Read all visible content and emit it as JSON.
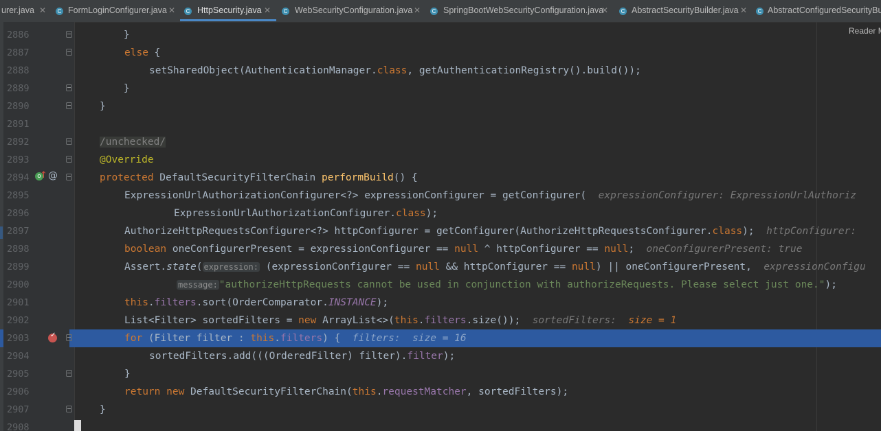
{
  "tabs": [
    {
      "label": "urer.java"
    },
    {
      "label": "FormLoginConfigurer.java"
    },
    {
      "label": "HttpSecurity.java"
    },
    {
      "label": "WebSecurityConfiguration.java"
    },
    {
      "label": "SpringBootWebSecurityConfiguration.java"
    },
    {
      "label": "AbstractSecurityBuilder.java"
    },
    {
      "label": "AbstractConfiguredSecurityBui"
    }
  ],
  "reader_mode_label": "Reader M",
  "lines": [
    {
      "n": "2886"
    },
    {
      "n": "2887"
    },
    {
      "n": "2888"
    },
    {
      "n": "2889"
    },
    {
      "n": "2890"
    },
    {
      "n": "2891"
    },
    {
      "n": "2892"
    },
    {
      "n": "2893"
    },
    {
      "n": "2894"
    },
    {
      "n": "2895"
    },
    {
      "n": "2896"
    },
    {
      "n": "2897"
    },
    {
      "n": "2898"
    },
    {
      "n": "2899"
    },
    {
      "n": "2900"
    },
    {
      "n": "2901"
    },
    {
      "n": "2902"
    },
    {
      "n": "2903"
    },
    {
      "n": "2904"
    },
    {
      "n": "2905"
    },
    {
      "n": "2906"
    },
    {
      "n": "2907"
    },
    {
      "n": "2908"
    }
  ],
  "code": {
    "l2886": "    }",
    "l2887_else": "else",
    "l2887_rest": " {",
    "l2888": "setSharedObject(AuthenticationManager.",
    "l2888_kw": "class",
    "l2888_rest": ", getAuthenticationRegistry().build());",
    "l2889": "    }",
    "l2890": "}",
    "l2892": "/unchecked/",
    "l2893": "@Override",
    "l2894_kw": "protected",
    "l2894_type": " DefaultSecurityFilterChain ",
    "l2894_fn": "performBuild",
    "l2894_rest": "() {",
    "l2895": "ExpressionUrlAuthorizationConfigurer<?> expressionConfigurer = getConfigurer(",
    "l2895_hint": "expressionConfigurer: ExpressionUrlAuthoriz",
    "l2896": "ExpressionUrlAuthorizationConfigurer.",
    "l2896_kw": "class",
    "l2896_rest": ");",
    "l2897": "AuthorizeHttpRequestsConfigurer<?> httpConfigurer = getConfigurer(AuthorizeHttpRequestsConfigurer.",
    "l2897_kw": "class",
    "l2897_rest": ");",
    "l2897_hint": "httpConfigurer:",
    "l2898_kw": "boolean",
    "l2898_a": " oneConfigurerPresent = expressionConfigurer == ",
    "l2898_null1": "null",
    "l2898_b": " ^ httpConfigurer == ",
    "l2898_null2": "null",
    "l2898_c": ";",
    "l2898_hint": "oneConfigurerPresent: true",
    "l2899_a": "Assert.",
    "l2899_state": "state",
    "l2899_b": "(",
    "l2899_param": "expression:",
    "l2899_c": " (expressionConfigurer == ",
    "l2899_null1": "null",
    "l2899_d": " && httpConfigurer == ",
    "l2899_null2": "null",
    "l2899_e": ") || oneConfigurerPresent,",
    "l2899_hint": "expressionConfigu",
    "l2900_param": "message:",
    "l2900_str": "\"authorizeHttpRequests cannot be used in conjunction with authorizeRequests. Please select just one.\"",
    "l2900_rest": ");",
    "l2901_this": "this",
    "l2901_a": ".",
    "l2901_filters": "filters",
    "l2901_b": ".sort(OrderComparator.",
    "l2901_inst": "INSTANCE",
    "l2901_c": ");",
    "l2902_a": "List<Filter> sortedFilters = ",
    "l2902_new": "new",
    "l2902_b": " ArrayList<>(",
    "l2902_this": "this",
    "l2902_c": ".",
    "l2902_filters": "filters",
    "l2902_d": ".size());",
    "l2902_hint": "sortedFilters:",
    "l2902_hintval": "size = 1",
    "l2903_for": "for",
    "l2903_a": " (Filter filter : ",
    "l2903_this": "this",
    "l2903_b": ".",
    "l2903_filters": "filters",
    "l2903_c": ") {",
    "l2903_hint": "filters:  size = 16",
    "l2904": "sortedFilters.add(((OrderedFilter) filter).",
    "l2904_fld": "filter",
    "l2904_rest": ");",
    "l2905": "}",
    "l2906_ret": "return",
    "l2906_new": "new",
    "l2906_a": " DefaultSecurityFilterChain(",
    "l2906_this": "this",
    "l2906_b": ".",
    "l2906_rm": "requestMatcher",
    "l2906_c": ", sortedFilters);",
    "l2907": "}"
  },
  "colors": {
    "background": "#2b2b2b",
    "keyword": "#cc7832",
    "field": "#9876aa",
    "function": "#ffc66d",
    "annotation": "#bbb529",
    "string": "#6a8759",
    "execution_line": "#2d5aa0"
  },
  "icons": {
    "breakpoint": "breakpoint-icon",
    "override": "override-icon",
    "class_tab": "class-c-icon"
  }
}
